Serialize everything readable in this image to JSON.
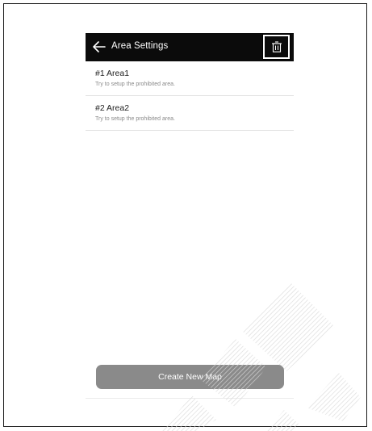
{
  "header": {
    "title": "Area Settings",
    "back_icon": "arrow-left-icon",
    "delete_icon": "trash-icon"
  },
  "areas": [
    {
      "title": "#1 Area1",
      "subtitle": "Try to setup the prohibited area."
    },
    {
      "title": "#2 Area2",
      "subtitle": "Try to setup the prohibited area."
    }
  ],
  "footer": {
    "create_button_label": "Create New Map"
  },
  "colors": {
    "header_bg": "#0b0b0b",
    "button_bg": "#8a8a8a",
    "highlight_border": "#ffffff"
  }
}
